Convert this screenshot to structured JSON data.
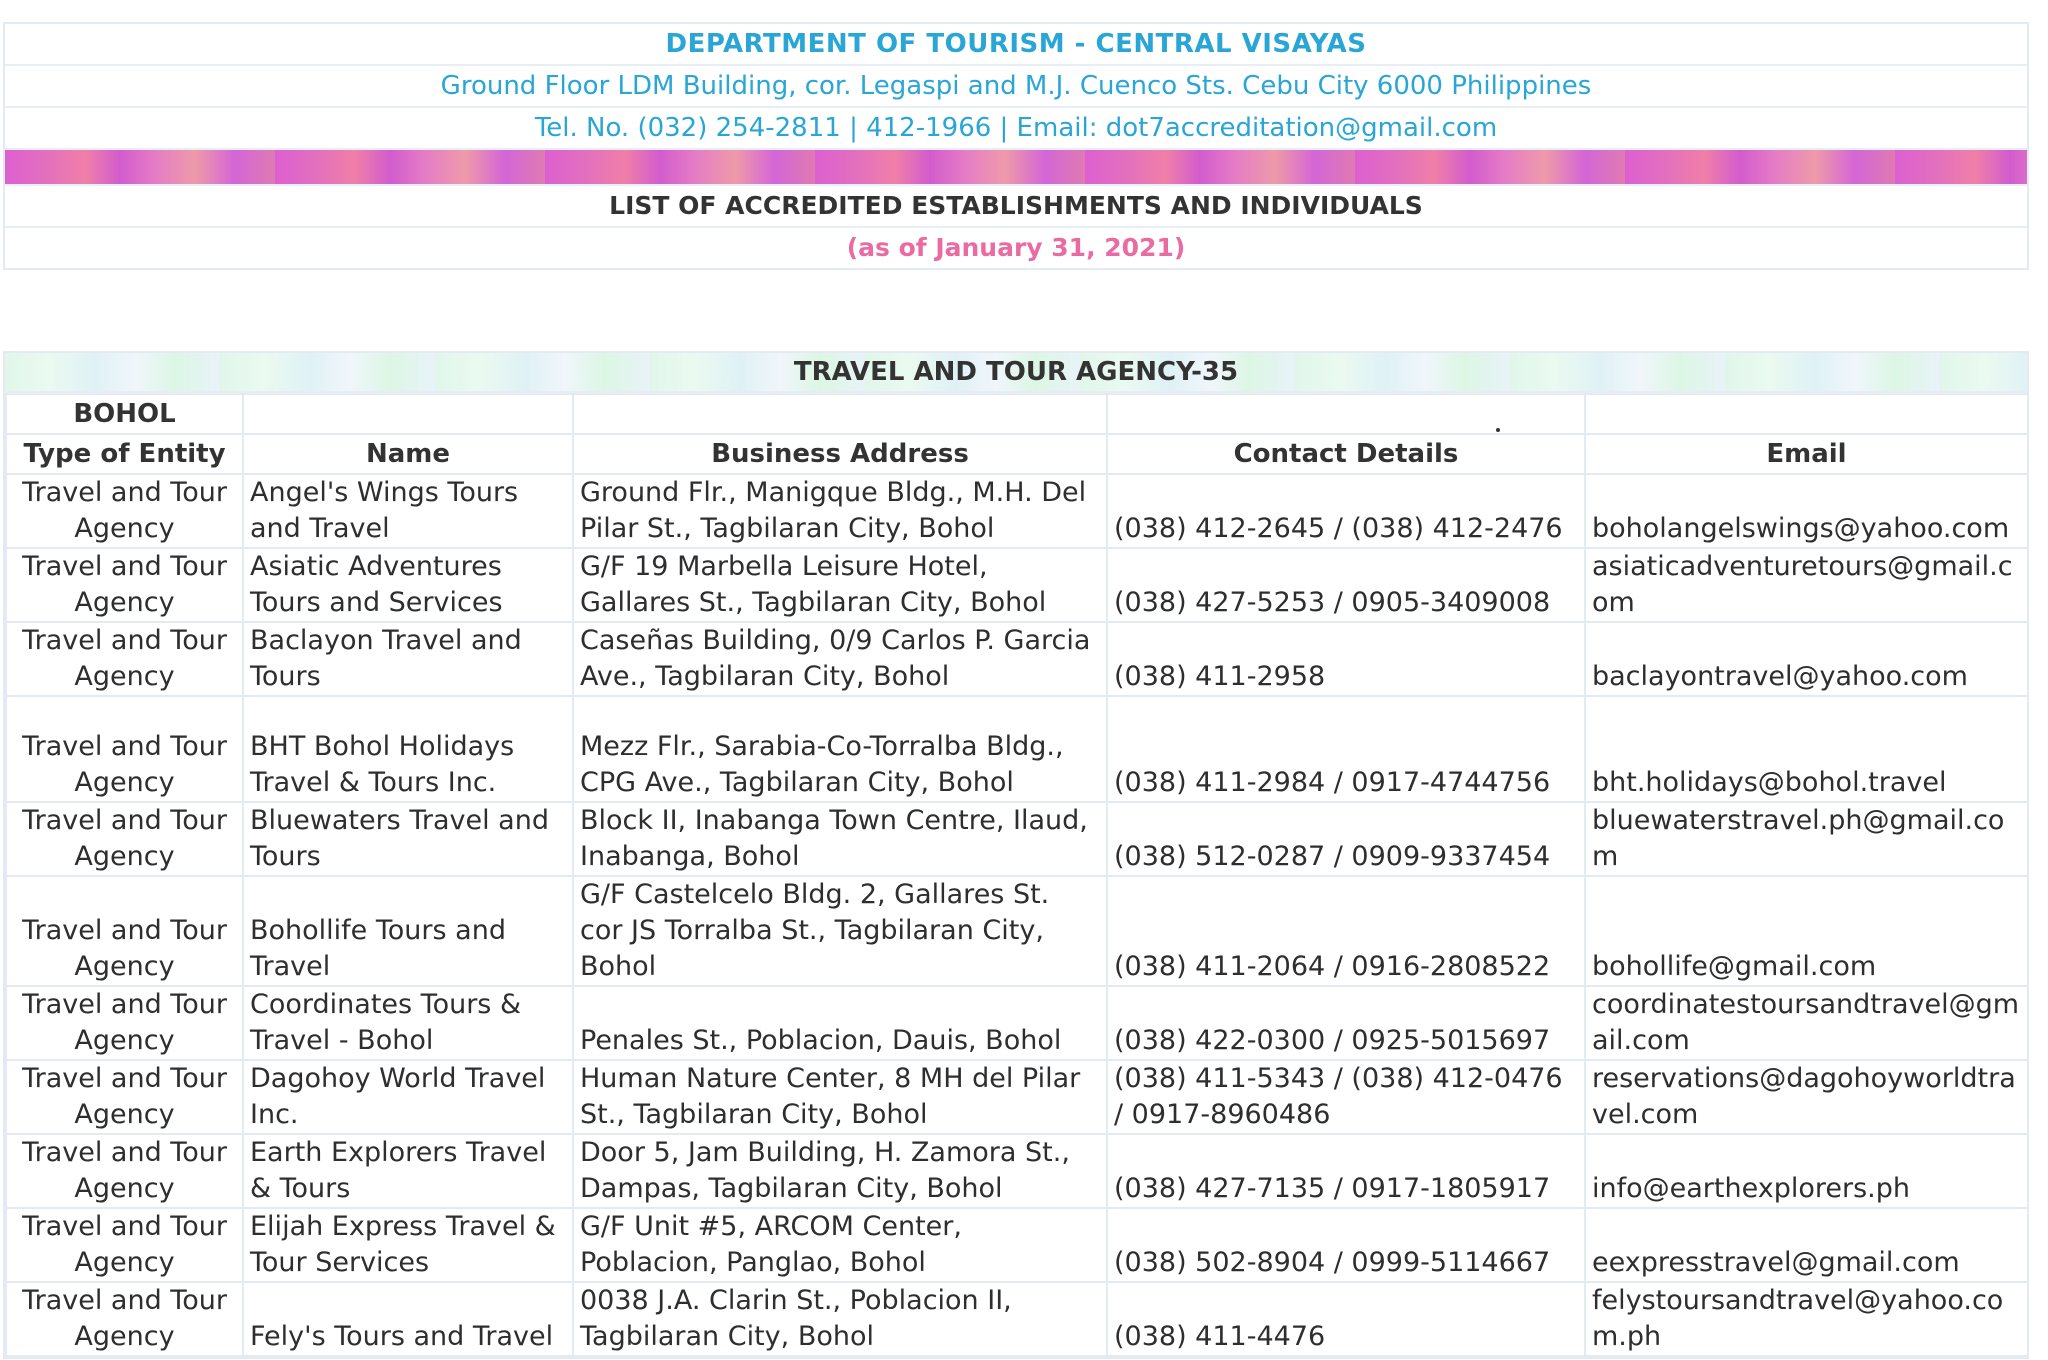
{
  "header": {
    "title": "DEPARTMENT OF TOURISM - CENTRAL VISAYAS",
    "address": "Ground Floor LDM Building, cor. Legaspi and M.J. Cuenco Sts. Cebu City 6000 Philippines",
    "contact": "Tel. No. (032) 254-2811 | 412-1966 | Email: dot7accreditation@gmail.com",
    "list_title": "LIST OF ACCREDITED ESTABLISHMENTS AND INDIVIDUALS",
    "as_of": "(as of January 31, 2021)"
  },
  "table": {
    "category": "TRAVEL AND TOUR AGENCY-35",
    "province": "BOHOL",
    "columns": [
      "Type of Entity",
      "Name",
      "Business Address",
      "Contact Details",
      "Email"
    ],
    "rows": [
      {
        "type": "Travel and Tour Agency",
        "name": "Angel's Wings Tours and Travel",
        "address": "Ground Flr., Manigque Bldg., M.H. Del Pilar St., Tagbilaran City, Bohol",
        "contact": "(038) 412-2645 / (038) 412-2476",
        "email": "boholangelswings@yahoo.com"
      },
      {
        "type": "Travel and Tour Agency",
        "name": "Asiatic Adventures Tours and Services",
        "address": "G/F 19 Marbella Leisure Hotel, Gallares St., Tagbilaran City, Bohol",
        "contact": "(038) 427-5253 / 0905-3409008",
        "email": "asiaticadventuretours@gmail.com"
      },
      {
        "type": "Travel and Tour Agency",
        "name": "Baclayon Travel and Tours",
        "address": "Caseñas Building, 0/9 Carlos P. Garcia Ave., Tagbilaran City, Bohol",
        "contact": "(038) 411-2958",
        "email": "baclayontravel@yahoo.com"
      },
      {
        "type": "Travel and Tour Agency",
        "name": "BHT Bohol Holidays Travel & Tours Inc.",
        "address": "Mezz Flr., Sarabia-Co-Torralba Bldg., CPG Ave., Tagbilaran City, Bohol",
        "contact": "(038) 411-2984 / 0917-4744756",
        "email": "bht.holidays@bohol.travel"
      },
      {
        "type": "Travel and Tour Agency",
        "name": "Bluewaters Travel and Tours",
        "address": "Block II, Inabanga Town Centre, Ilaud, Inabanga, Bohol",
        "contact": "(038) 512-0287 / 0909-9337454",
        "email": "bluewaterstravel.ph@gmail.com"
      },
      {
        "type": "Travel and Tour Agency",
        "name": "Bohollife Tours and Travel",
        "address": "G/F Castelcelo Bldg. 2, Gallares St. cor JS Torralba St., Tagbilaran City, Bohol",
        "contact": "(038) 411-2064 / 0916-2808522",
        "email": "bohollife@gmail.com"
      },
      {
        "type": "Travel and Tour Agency",
        "name": "Coordinates Tours & Travel - Bohol",
        "address": "Penales St., Poblacion, Dauis, Bohol",
        "contact": "(038) 422-0300 / 0925-5015697",
        "email": "coordinatestoursandtravel@gmail.com"
      },
      {
        "type": "Travel and Tour Agency",
        "name": "Dagohoy World Travel Inc.",
        "address": "Human Nature Center, 8 MH del Pilar St., Tagbilaran City, Bohol",
        "contact": "(038) 411-5343 / (038) 412-0476 / 0917-8960486",
        "email": "reservations@dagohoyworldtravel.com"
      },
      {
        "type": "Travel and Tour Agency",
        "name": "Earth Explorers Travel & Tours",
        "address": "Door 5, Jam Building, H. Zamora St., Dampas, Tagbilaran City, Bohol",
        "contact": "(038) 427-7135 / 0917-1805917",
        "email": "info@earthexplorers.ph"
      },
      {
        "type": "Travel and Tour Agency",
        "name": "Elijah Express Travel & Tour Services",
        "address": "G/F Unit #5, ARCOM Center, Poblacion, Panglao, Bohol",
        "contact": "(038) 502-8904 / 0999-5114667",
        "email": "eexpresstravel@gmail.com"
      },
      {
        "type": "Travel and Tour Agency",
        "name": "Fely's Tours and Travel",
        "address": "0038 J.A. Clarin St., Poblacion II, Tagbilaran City, Bohol",
        "contact": "(038) 411-4476",
        "email": "felystoursandtravel@yahoo.com.ph"
      }
    ]
  }
}
